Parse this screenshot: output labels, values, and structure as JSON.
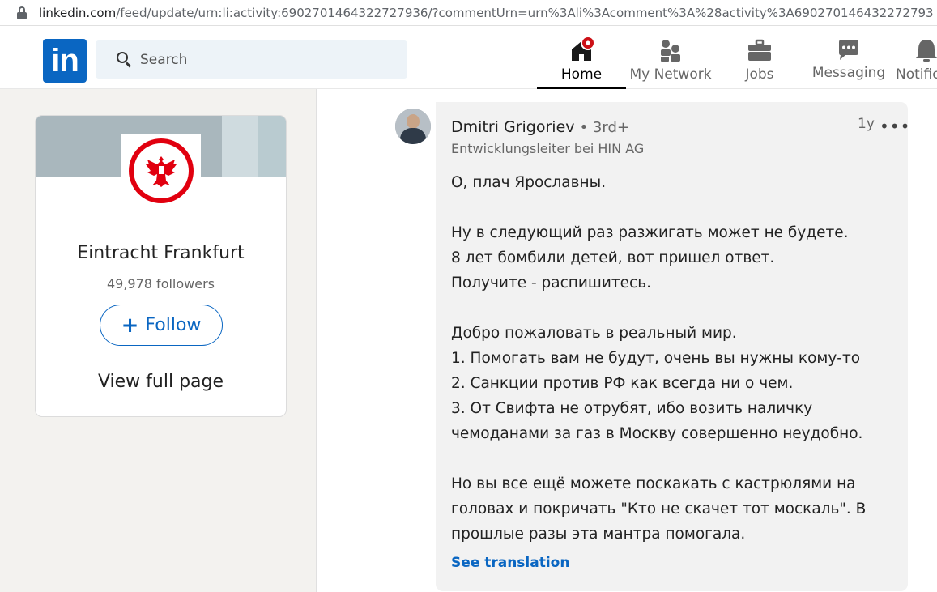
{
  "browser": {
    "url_host": "linkedin.com",
    "url_path": "/feed/update/urn:li:activity:6902701464322727936/?commentUrn=urn%3Ali%3Acomment%3A%28activity%3A690270146432272793"
  },
  "nav": {
    "logo": "in",
    "search_placeholder": "Search",
    "items": [
      {
        "label": "Home",
        "icon": "home-icon"
      },
      {
        "label": "My Network",
        "icon": "network-icon"
      },
      {
        "label": "Jobs",
        "icon": "briefcase-icon"
      },
      {
        "label": "Messaging",
        "icon": "messaging-icon"
      },
      {
        "label": "Notific",
        "icon": "bell-icon"
      }
    ]
  },
  "company_card": {
    "name": "Eintracht Frankfurt",
    "followers": "49,978 followers",
    "follow_label": "Follow",
    "view_full_page": "View full page"
  },
  "comment": {
    "author": "Dmitri Grigoriev",
    "degree": "• 3rd+",
    "headline": "Entwicklungsleiter bei HIN AG",
    "time": "1y",
    "lines": [
      "О, плач Ярославны.",
      "",
      "Ну в следующий раз разжигать может не будете.",
      "8 лет бомбили детей, вот пришел ответ.",
      "Получите - распишитесь.",
      "",
      "Добро пожаловать в реальный мир.",
      "1. Помогать вам не будут, очень вы нужны кому-то",
      "2. Санкции против РФ как всегда ни о чем.",
      "3. От Свифта не отрубят, ибо возить наличку",
      "чемоданами за газ в Москву совершенно неудобно.",
      "",
      "Но вы все ещё можете поскакать с кастрюлями на",
      "головах и покричать \"Кто не скачет тот москаль\". В",
      "прошлые разы эта мантра помогала."
    ],
    "see_translation": "See translation"
  },
  "colors": {
    "linkedin_blue": "#0a66c2",
    "notification_red": "#cc1016",
    "background": "#f3f2ef"
  }
}
